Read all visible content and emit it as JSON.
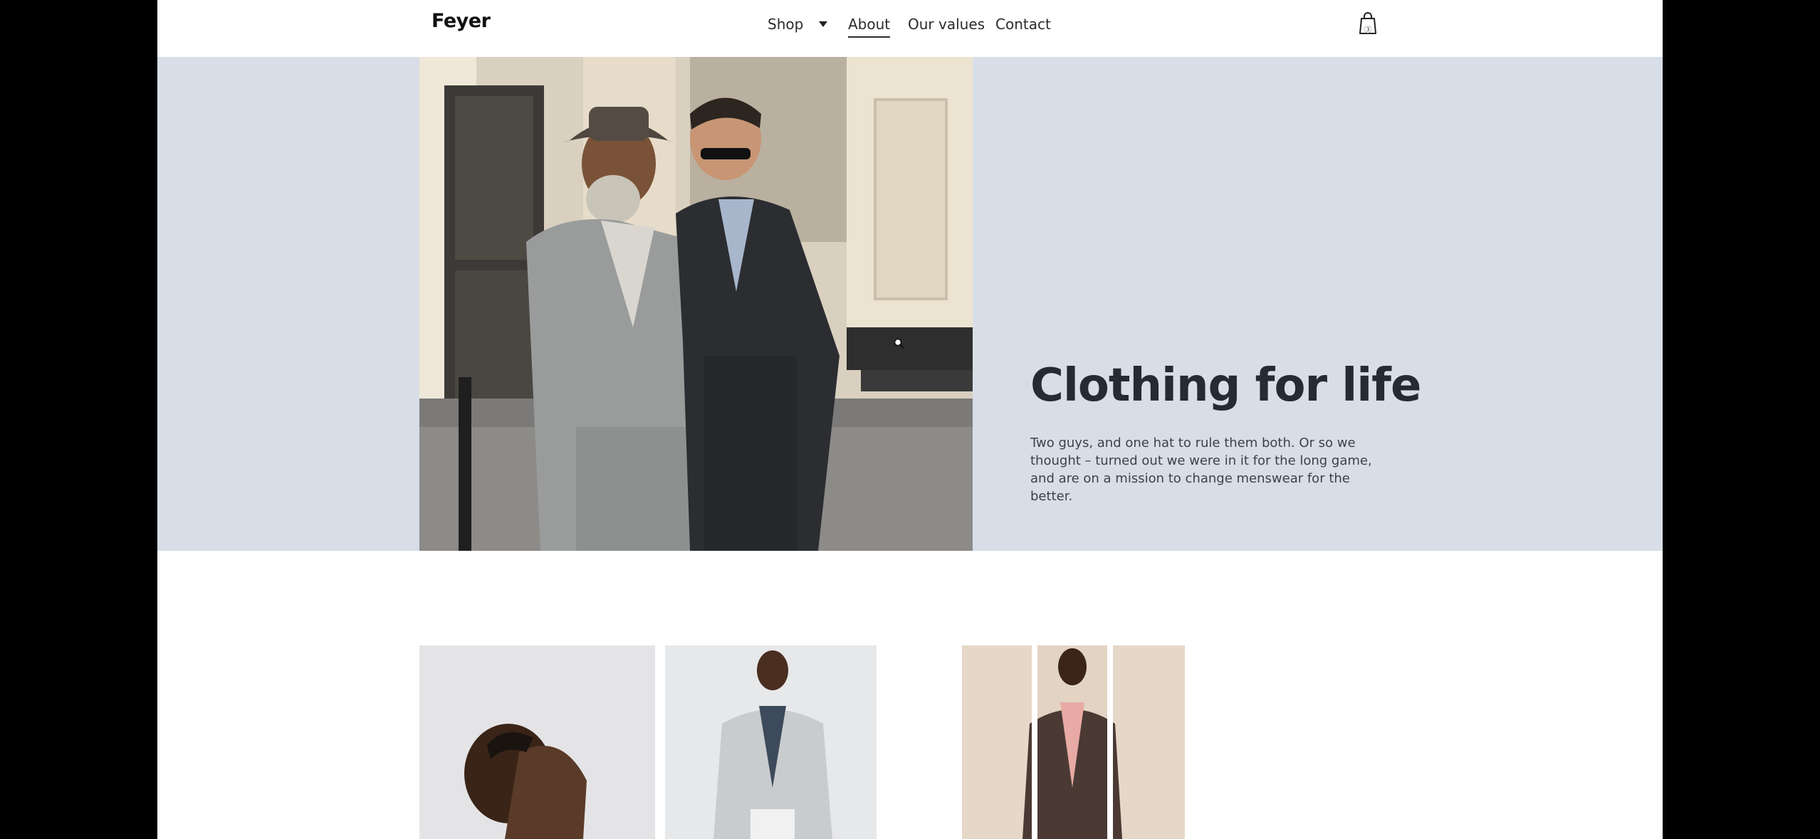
{
  "brand": {
    "logo": "Feyer"
  },
  "nav": {
    "items": [
      {
        "label": "Shop"
      },
      {
        "label": "About"
      },
      {
        "label": "Our values"
      },
      {
        "label": "Contact"
      }
    ]
  },
  "cart": {
    "count": "3",
    "icon": "shopping-bag-icon"
  },
  "hero": {
    "title": "Clothing for life",
    "body": "Two guys, and one hat to rule them both. Or so we thought – turned out we were in it for the long game, and are on a mission to change menswear for the better."
  },
  "colors": {
    "hero_bg": "#d8dee7",
    "page_bg": "#ffffff",
    "letterbox": "#000000",
    "text_dark": "#262b33"
  }
}
